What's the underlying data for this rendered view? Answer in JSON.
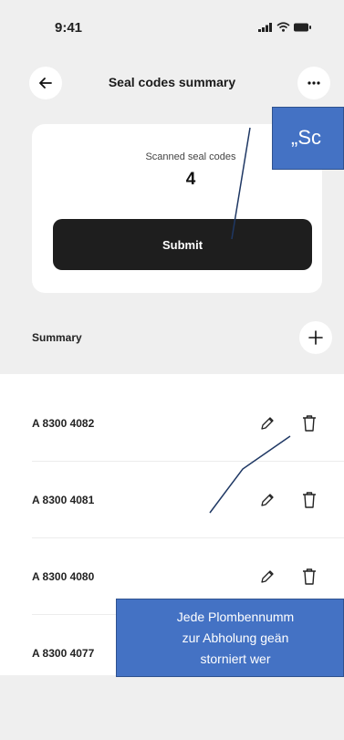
{
  "status_bar": {
    "time": "9:41"
  },
  "header": {
    "title": "Seal codes summary",
    "back_icon": "arrow-left-icon",
    "more_icon": "more-horizontal-icon"
  },
  "scan_card": {
    "label": "Scanned seal codes",
    "count": "4",
    "submit_label": "Submit"
  },
  "summary": {
    "title": "Summary",
    "add_icon": "plus-icon",
    "items": [
      {
        "code": "A 8300 4082"
      },
      {
        "code": "A 8300 4081"
      },
      {
        "code": "A 8300 4080"
      },
      {
        "code": "A 8300 4077"
      }
    ]
  },
  "annotations": {
    "top_callout": "„Sc",
    "bottom_callout_lines": [
      "Jede Plombennumm",
      "zur Abholung geän",
      "storniert wer"
    ]
  },
  "colors": {
    "background": "#efefef",
    "card": "#ffffff",
    "button": "#1e1e1e",
    "callout": "#4472c4"
  }
}
